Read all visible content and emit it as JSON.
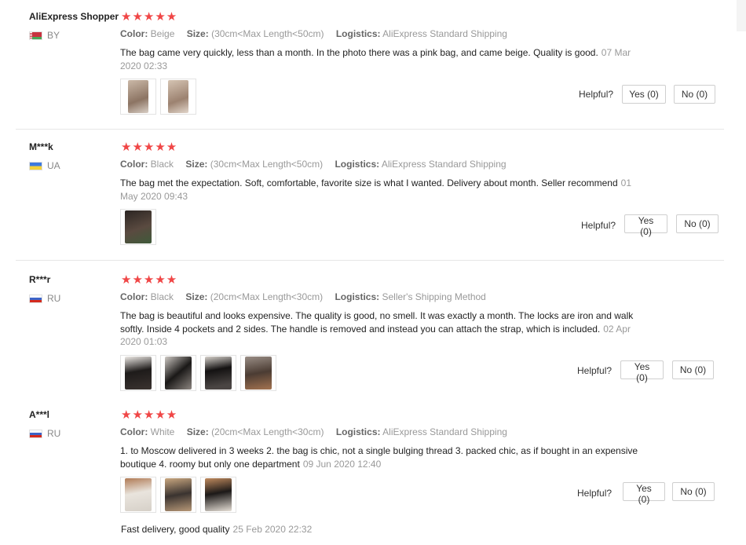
{
  "labels": {
    "color": "Color:",
    "size": "Size:",
    "logistics": "Logistics:",
    "helpful": "Helpful?"
  },
  "reviews": [
    {
      "user": "AliExpress Shopper",
      "country": "BY",
      "rating": 5,
      "stars": "★★★★★",
      "color": "Beige",
      "size": "(30cm<Max Length<50cm)",
      "logistics": "AliExpress Standard Shipping",
      "text": "The bag came very quickly, less than a month. In the photo there was a pink bag, and came beige. Quality is good.",
      "date": "07 Mar 2020 02:33",
      "photo_count": 2,
      "yes": "Yes (0)",
      "no": "No (0)"
    },
    {
      "user": "M***k",
      "country": "UA",
      "rating": 5,
      "stars": "★★★★★",
      "color": "Black",
      "size": "(30cm<Max Length<50cm)",
      "logistics": "AliExpress Standard Shipping",
      "text": "The bag met the expectation. Soft, comfortable, favorite size is what I wanted. Delivery about month. Seller recommend",
      "date": "01 May 2020 09:43",
      "photo_count": 1,
      "yes": "Yes (0)",
      "no": "No (0)"
    },
    {
      "user": "R***r",
      "country": "RU",
      "rating": 5,
      "stars": "★★★★★",
      "color": "Black",
      "size": "(20cm<Max Length<30cm)",
      "logistics": "Seller's Shipping Method",
      "text": "The bag is beautiful and looks expensive. The quality is good, no smell. It was exactly a month. The locks are iron and walk softly. Inside 4 pockets and 2 sides. The handle is removed and instead you can attach the strap, which is included.",
      "date": "02 Apr 2020 01:03",
      "photo_count": 4,
      "yes": "Yes (0)",
      "no": "No (0)"
    },
    {
      "user": "A***l",
      "country": "RU",
      "rating": 5,
      "stars": "★★★★★",
      "color": "White",
      "size": "(20cm<Max Length<30cm)",
      "logistics": "AliExpress Standard Shipping",
      "text": "1. to Moscow delivered in 3 weeks 2. the bag is chic, not a single bulging thread 3. packed chic, as if bought in an expensive boutique 4. roomy but only one department",
      "date": "09 Jun 2020 12:40",
      "photo_count": 3,
      "yes": "Yes (0)",
      "no": "No (0)"
    }
  ],
  "additional_feedback": {
    "text": "Fast delivery, good quality",
    "date": "25 Feb 2020 22:32"
  },
  "colors": {
    "star": "#f04646",
    "muted_text": "#999999"
  }
}
